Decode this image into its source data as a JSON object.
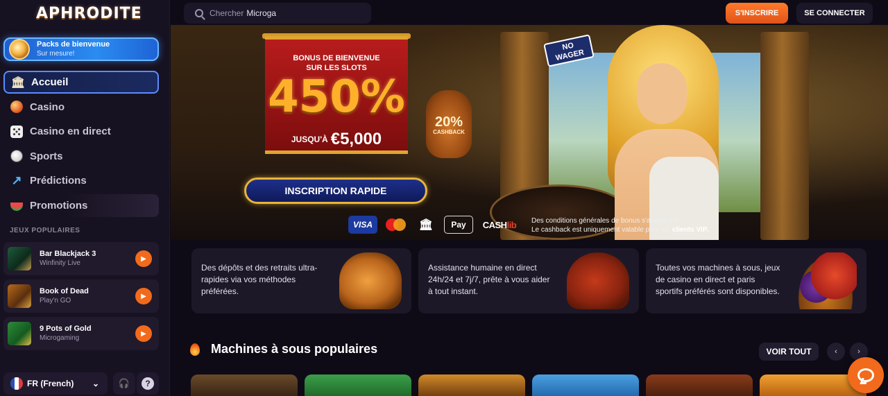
{
  "brand": {
    "logo_text": "APHRODITE"
  },
  "header": {
    "search_label": "Chercher",
    "search_value": "Microga",
    "signup_label": "S'INSCRIRE",
    "login_label": "SE CONNECTER"
  },
  "sidebar": {
    "promo": {
      "title": "Packs de bienvenue",
      "subtitle": "Sur mesure!"
    },
    "nav": [
      {
        "label": "Accueil",
        "icon": "temple-icon"
      },
      {
        "label": "Casino",
        "icon": "chip-icon"
      },
      {
        "label": "Casino en direct",
        "icon": "dice-icon"
      },
      {
        "label": "Sports",
        "icon": "soccer-ball-icon"
      },
      {
        "label": "Prédictions",
        "icon": "trend-arrow-icon"
      },
      {
        "label": "Promotions",
        "icon": "watermelon-icon"
      }
    ],
    "popular_label": "JEUX POPULAIRES",
    "games": [
      {
        "name": "Bar Blackjack 3",
        "provider": "Winfinity Live"
      },
      {
        "name": "Book of Dead",
        "provider": "Play'n GO"
      },
      {
        "name": "9 Pots of Gold",
        "provider": "Microgaming"
      }
    ],
    "language": "FR (French)"
  },
  "hero": {
    "bonus_line1": "BONUS DE BIENVENUE",
    "bonus_line2": "SUR LES SLOTS",
    "bonus_percent": "450%",
    "upto_prefix": "JUSQU'À",
    "upto_amount": "€5,000",
    "cashback_pct": "20%",
    "cashback_label": "CASHBACK",
    "no_wager_1": "NO",
    "no_wager_2": "WAGER",
    "cta_label": "INSCRIPTION RAPIDE",
    "payments": {
      "visa": "VISA",
      "applepay": "Pay",
      "cashlib_a": "CASH",
      "cashlib_b": "lib"
    },
    "disclaimer_1": "Des conditions générales de bonus s'appliquent.",
    "disclaimer_2": "Le cashback est uniquement valable pour les",
    "disclaimer_vip": "clients VIP."
  },
  "features": [
    {
      "text": "Des dépôts et des retraits ultra-rapides via vos méthodes préférées."
    },
    {
      "text": "Assistance humaine en direct 24h/24 et 7j/7, prête à vous aider à tout instant."
    },
    {
      "text": "Toutes vos machines à sous, jeux de casino en direct et paris sportifs préférés sont disponibles."
    }
  ],
  "slots_section": {
    "title": "Machines à sous populaires",
    "view_all_label": "VOIR TOUT"
  },
  "colors": {
    "accent": "#f26a1b",
    "sidebar_bg": "#171221",
    "page_bg": "#0f0b16",
    "active_border": "#5b8cff"
  }
}
